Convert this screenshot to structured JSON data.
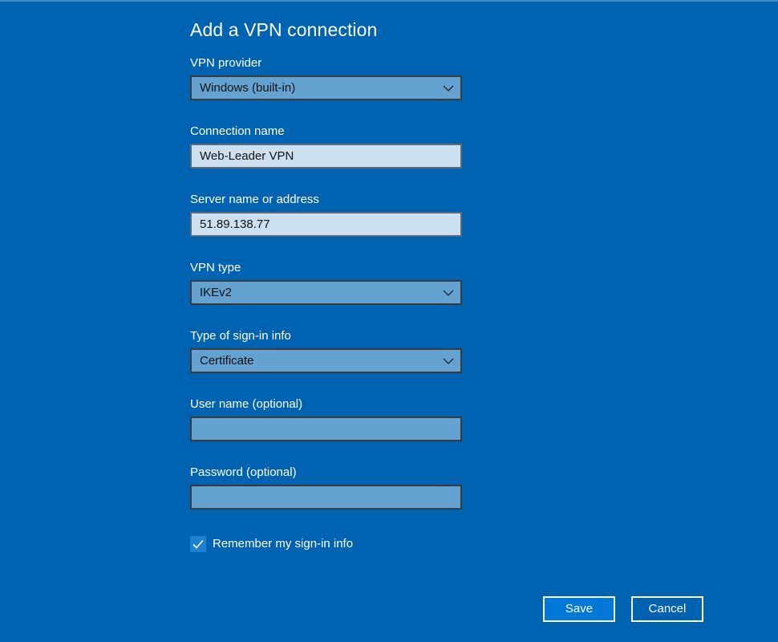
{
  "dialog": {
    "title": "Add a VPN connection"
  },
  "fields": {
    "vpn_provider": {
      "label": "VPN provider",
      "value": "Windows (built-in)"
    },
    "connection_name": {
      "label": "Connection name",
      "value": "Web-Leader VPN"
    },
    "server": {
      "label": "Server name or address",
      "value": "51.89.138.77"
    },
    "vpn_type": {
      "label": "VPN type",
      "value": "IKEv2"
    },
    "signin_type": {
      "label": "Type of sign-in info",
      "value": "Certificate"
    },
    "username": {
      "label": "User name (optional)",
      "value": ""
    },
    "password": {
      "label": "Password (optional)",
      "value": ""
    }
  },
  "remember": {
    "label": "Remember my sign-in info",
    "checked": true
  },
  "buttons": {
    "save": "Save",
    "cancel": "Cancel"
  },
  "icons": {
    "dropdown": "chevron-down-icon",
    "checkbox": "checkmark-icon"
  },
  "colors": {
    "background": "#0063b1",
    "field_bg": "#64a2d2",
    "field_filled_bg": "#cde0f0",
    "checkbox_bg": "#1f7fd1",
    "save_button_bg": "#0078d7"
  }
}
